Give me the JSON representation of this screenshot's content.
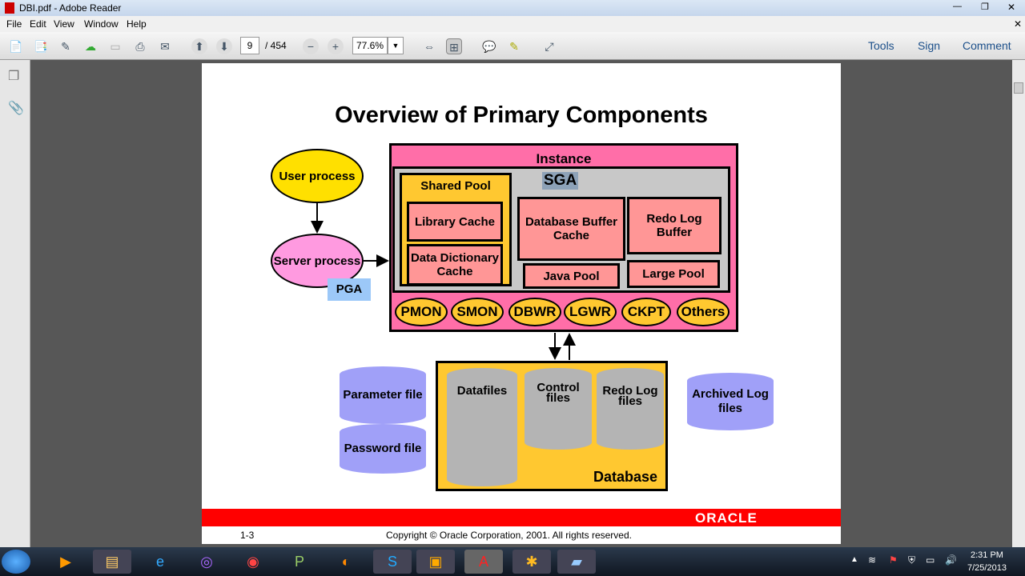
{
  "window": {
    "title": "DBI.pdf - Adobe Reader"
  },
  "menu": [
    "File",
    "Edit",
    "View",
    "Window",
    "Help"
  ],
  "toolbar": {
    "page_current": "9",
    "page_total": "/ 454",
    "zoom": "77.6%",
    "tools": "Tools",
    "sign": "Sign",
    "comment": "Comment"
  },
  "slide": {
    "title": "Overview of Primary Components",
    "instance": "Instance",
    "sga": "SGA",
    "shared_pool": "Shared Pool",
    "library_cache": "Library Cache",
    "data_dictionary_cache": "Data Dictionary Cache",
    "db_buffer_cache": "Database Buffer Cache",
    "redo_log_buffer": "Redo Log Buffer",
    "java_pool": "Java Pool",
    "large_pool": "Large Pool",
    "processes": [
      "PMON",
      "SMON",
      "DBWR",
      "LGWR",
      "CKPT",
      "Others"
    ],
    "user_process": "User process",
    "server_process": "Server process",
    "pga": "PGA",
    "parameter_file": "Parameter file",
    "password_file": "Password file",
    "datafiles": "Datafiles",
    "control_files": "Control files",
    "redo_log_files": "Redo Log files",
    "database": "Database",
    "archived_log_files": "Archived Log files",
    "brand": "ORACLE",
    "page_number": "1-3",
    "copyright": "Copyright © Oracle Corporation, 2001. All rights reserved."
  },
  "clock": {
    "time": "2:31 PM",
    "date": "7/25/2013"
  }
}
